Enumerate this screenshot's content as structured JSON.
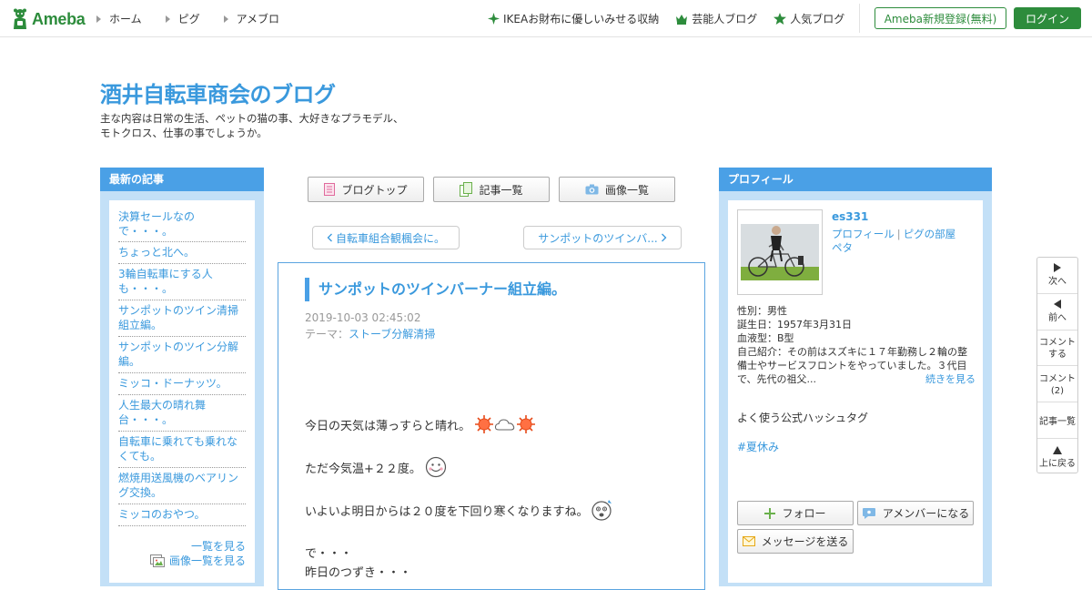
{
  "header": {
    "logo": "Ameba",
    "nav": [
      "ホーム",
      "ピグ",
      "アメブロ"
    ],
    "links": [
      {
        "label": "IKEAお財布に優しいみせる収納",
        "icon": "sparkle-icon"
      },
      {
        "label": "芸能人ブログ",
        "icon": "crown-icon"
      },
      {
        "label": "人気ブログ",
        "icon": "star-icon"
      }
    ],
    "register_label": "Ameba新規登録(無料)",
    "login_label": "ログイン"
  },
  "blog": {
    "title": "酒井自転車商会のブログ",
    "description_line1": "主な内容は日常の生活、ペットの猫の事、大好きなプラモデル、",
    "description_line2": "モトクロス、仕事の事でしょうか。"
  },
  "latest": {
    "heading": "最新の記事",
    "items": [
      "決算セールなので・・・。",
      "ちょっと北へ。",
      "3輪自転車にする人も・・・。",
      "サンポットのツイン清掃組立編。",
      "サンポットのツイン分解編。",
      "ミッコ・ドーナッツ。",
      "人生最大の晴れ舞台・・・。",
      "自転車に乗れても乗れなくても。",
      "燃焼用送風機のベアリング交換。",
      "ミッコのおやつ。"
    ],
    "more_label": "一覧を見る",
    "images_label": "画像一覧を見る"
  },
  "toolbar": {
    "blog_top": "ブログトップ",
    "articles": "記事一覧",
    "images": "画像一覧"
  },
  "pager": {
    "prev": "自転車組合観楓会に。",
    "next": "サンポットのツインバ..."
  },
  "article": {
    "title": "サンポットのツインバーナー組立編。",
    "date": "2019-10-03 02:45:02",
    "theme_label": "テーマ：",
    "theme": "ストーブ分解清掃",
    "lines": [
      "今日の天気は薄っすらと晴れ。",
      "ただ今気温+２２度。",
      "いよいよ明日からは２０度を下回り寒くなりますね。",
      "で・・・",
      "昨日のつずき・・・"
    ]
  },
  "profile": {
    "heading": "プロフィール",
    "name": "es331",
    "link1": "プロフィール",
    "link_sep": "|",
    "link2": "ピグの部屋",
    "link3": "ペタ",
    "gender": "性別：男性",
    "birthday": "誕生日：1957年3月31日",
    "blood": "血液型：B型",
    "intro": "自己紹介：その前はスズキに１７年勤務し２輪の整備士やサービスフロントをやっていました。３代目で、先代の祖父...",
    "more": "続きを見る",
    "hashtag_title": "よく使う公式ハッシュタグ",
    "hashtag": "#夏休み",
    "follow": "フォロー",
    "member": "アメンバーになる",
    "message": "メッセージを送る"
  },
  "sidenav": {
    "next": "次へ",
    "prev": "前へ",
    "comment1": "コメント",
    "comment2": "する",
    "comments1": "コメント",
    "comments2": "(2)",
    "list": "記事一覧",
    "top": "上に戻る"
  },
  "colors": {
    "brand_green": "#2d8c3c",
    "accent_blue": "#3a99dd",
    "box_blue": "#4aa0e6",
    "box_bg": "#c3e0f7"
  }
}
